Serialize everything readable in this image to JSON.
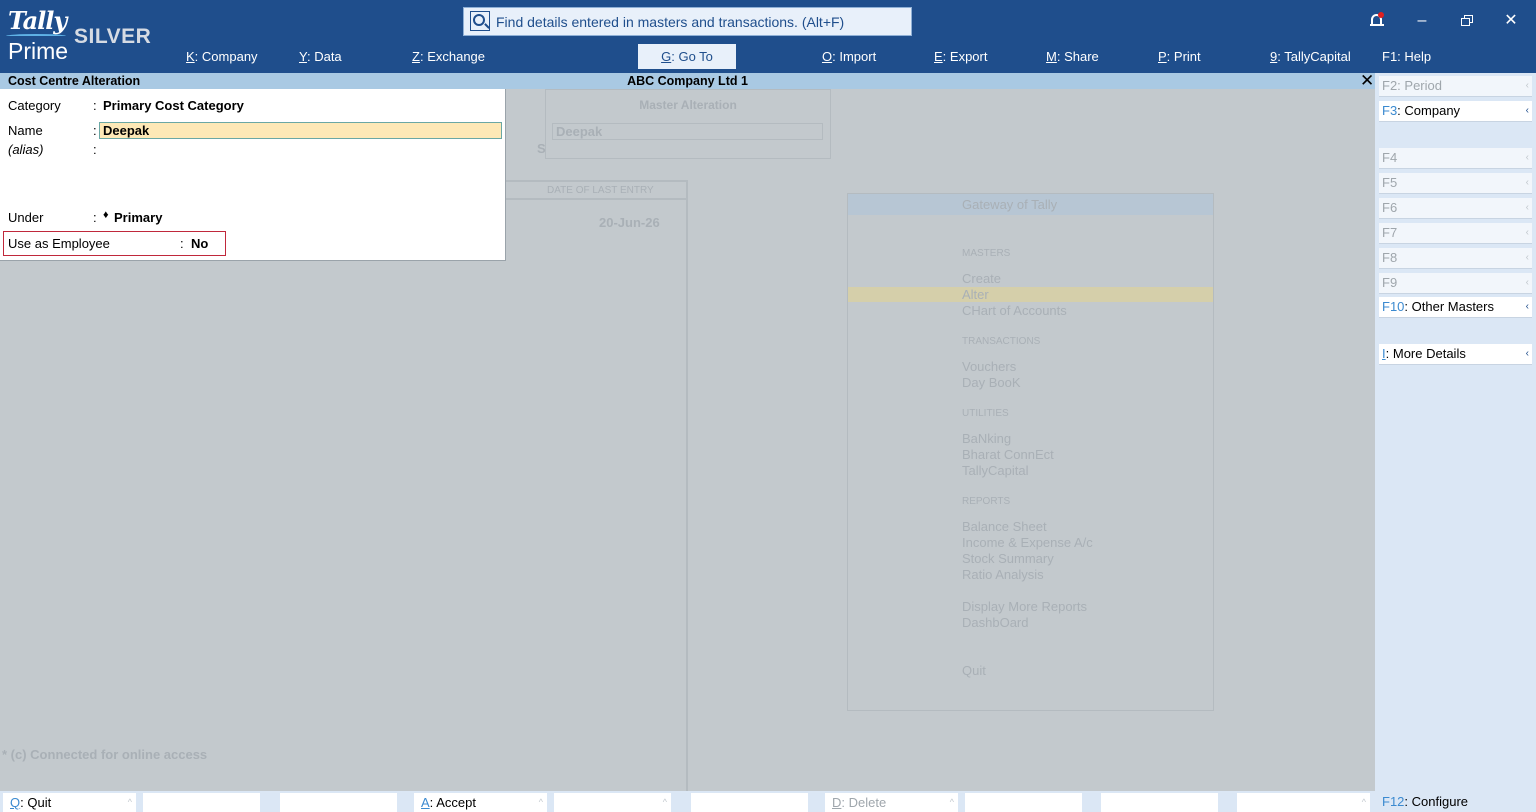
{
  "app": {
    "logo_top": "Tally",
    "logo_bottom": "Prime",
    "edition": "SILVER"
  },
  "search": {
    "text": "Find details entered in masters and transactions. (Alt+F)"
  },
  "window_controls": {
    "minimize": "–",
    "close": "✕"
  },
  "menu": [
    {
      "key": "K",
      "label": "Company"
    },
    {
      "key": "Y",
      "label": "Data"
    },
    {
      "key": "Z",
      "label": "Exchange"
    },
    {
      "key": "G",
      "label": "Go To"
    },
    {
      "key": "O",
      "label": "Import"
    },
    {
      "key": "E",
      "label": "Export"
    },
    {
      "key": "M",
      "label": "Share"
    },
    {
      "key": "P",
      "label": "Print"
    },
    {
      "key": "9",
      "label": "TallyCapital"
    },
    {
      "key": "F1",
      "label": "Help"
    }
  ],
  "titlebar": {
    "screen": "Cost Centre Alteration",
    "company": "ABC Company Ltd 1",
    "close": "✕"
  },
  "form": {
    "category_label": "Category",
    "category_value": "Primary Cost Category",
    "name_label": "Name",
    "name_value": "Deepak",
    "alias_label": "(alias)",
    "under_label": "Under",
    "under_value": "Primary",
    "employee_label": "Use as Employee",
    "employee_value": "No",
    "colon": ":"
  },
  "background": {
    "master_alteration": "Master Alteration",
    "master_value": "Deepak",
    "date_header": "DATE OF LAST ENTRY",
    "date_value": "20-Jun-26",
    "s_char": "S",
    "connected": "* (c) Connected for online access",
    "gateway": {
      "title": "Gateway of Tally",
      "masters": "MASTERS",
      "create": "Create",
      "alter": "Alter",
      "chart": "CHart of Accounts",
      "transactions": "TRANSACTIONS",
      "vouchers": "Vouchers",
      "daybook": "Day BooK",
      "utilities": "UTILITIES",
      "banking": "BaNking",
      "bharat": "Bharat ConnEct",
      "tallycapital": "TallyCapital",
      "reports": "REPORTS",
      "balance": "Balance Sheet",
      "income": "Income & Expense A/c",
      "stock": "Stock Summary",
      "ratio": "Ratio Analysis",
      "display_more": "Display More Reports",
      "dashboard": "DashbOard",
      "quit": "Quit"
    }
  },
  "right_panel": [
    {
      "key": "F2",
      "label": "Period",
      "state": "off"
    },
    {
      "key": "F3",
      "label": "Company",
      "state": "on"
    },
    {
      "key": "F4",
      "label": "",
      "state": "off"
    },
    {
      "key": "F5",
      "label": "",
      "state": "off"
    },
    {
      "key": "F6",
      "label": "",
      "state": "off"
    },
    {
      "key": "F7",
      "label": "",
      "state": "off"
    },
    {
      "key": "F8",
      "label": "",
      "state": "off"
    },
    {
      "key": "F9",
      "label": "",
      "state": "off"
    },
    {
      "key": "F10",
      "label": "Other Masters",
      "state": "on"
    },
    {
      "key": "I",
      "label": "More Details",
      "state": "on"
    }
  ],
  "footer": [
    {
      "key": "Q",
      "label": "Quit",
      "state": "on"
    },
    {
      "key": "",
      "label": "",
      "state": "off"
    },
    {
      "key": "",
      "label": "",
      "state": "off"
    },
    {
      "key": "A",
      "label": "Accept",
      "state": "on"
    },
    {
      "key": "",
      "label": "",
      "state": "off"
    },
    {
      "key": "",
      "label": "",
      "state": "off"
    },
    {
      "key": "D",
      "label": "Delete",
      "state": "off"
    },
    {
      "key": "",
      "label": "",
      "state": "off"
    },
    {
      "key": "",
      "label": "",
      "state": "off"
    },
    {
      "key": "",
      "label": "",
      "state": "off"
    }
  ],
  "configure": {
    "key": "F12",
    "label": "Configure"
  },
  "colors": {
    "header_bg": "#1f4e8c",
    "titlebar_bg": "#a9c9e3",
    "input_bg": "#fde8b6",
    "highlight_border": "#c0283b",
    "key_color": "#3b8ad0"
  }
}
